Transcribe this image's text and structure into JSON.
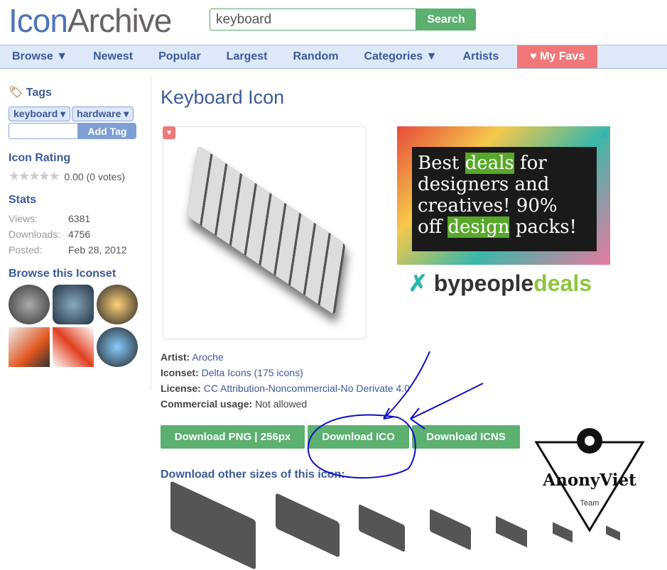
{
  "header": {
    "logo_a": "Icon",
    "logo_b": "Archive",
    "search_value": "keyboard",
    "search_button": "Search"
  },
  "nav": [
    "Browse ▼",
    "Newest",
    "Popular",
    "Largest",
    "Random",
    "Categories ▼",
    "Artists",
    "♥ My Favs"
  ],
  "sidebar": {
    "tags_title": "Tags",
    "tags": [
      "keyboard ▾",
      "hardware ▾"
    ],
    "add_tag": "Add Tag",
    "rating_title": "Icon Rating",
    "rating_value": "0.00 (0 votes)",
    "rating_fraction": 0,
    "stats_title": "Stats",
    "stats": [
      {
        "label": "Views:",
        "value": "6381"
      },
      {
        "label": "Downloads:",
        "value": "4756"
      },
      {
        "label": "Posted:",
        "value": "Feb 28, 2012"
      }
    ],
    "browse_title": "Browse this Iconset"
  },
  "main": {
    "title": "Keyboard Icon",
    "meta": [
      {
        "label": "Artist:",
        "value": "Aroche"
      },
      {
        "label": "Iconset:",
        "value": "Delta Icons (175 icons)"
      },
      {
        "label": "License:",
        "value": "CC Attribution-Noncommercial-No Derivate 4.0"
      },
      {
        "label": "Commercial usage:",
        "value": "Not allowed"
      }
    ],
    "buttons": [
      "Download PNG | 256px",
      "Download ICO",
      "Download ICNS"
    ],
    "other_sizes": "Download other sizes of this icon:"
  },
  "ad": {
    "l1a": "Best ",
    "l1b": "deals",
    "l1c": " for",
    "l2": "designers and",
    "l3": "creatives! 90%",
    "l4a": "off ",
    "l4b": "design",
    "l4c": " packs!",
    "brand_a": "bypeople",
    "brand_b": "deals"
  },
  "watermark": {
    "name": "AnonyViet",
    "sub": "Team"
  },
  "colors": {
    "accent": "#3d5a99",
    "green": "#5cb070",
    "fav": "#f07878",
    "annotation": "#1010c8"
  }
}
